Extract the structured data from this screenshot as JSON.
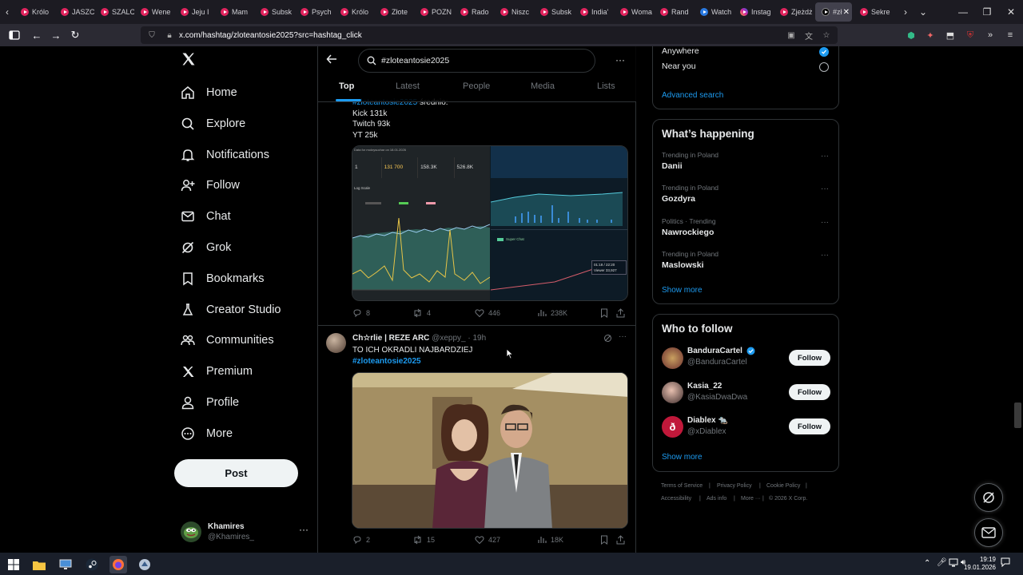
{
  "browser": {
    "tabs": [
      "Królo",
      "JASZC",
      "SZALC",
      "Wene",
      "Jeju I",
      "Mam",
      "Subsk",
      "Psych",
      "Królo",
      "Złote",
      "POZN",
      "Rado",
      "Niszc",
      "Subsk",
      "India'",
      "Woma",
      "Rand",
      "Watch",
      "Instag",
      "Zjeżdż",
      "#zł",
      "Sekre"
    ],
    "url": "x.com/hashtag/zloteantosie2025?src=hashtag_click"
  },
  "nav": {
    "items": [
      "Home",
      "Explore",
      "Notifications",
      "Follow",
      "Chat",
      "Grok",
      "Bookmarks",
      "Creator Studio",
      "Communities",
      "Premium",
      "Profile",
      "More"
    ],
    "post_label": "Post",
    "account_name": "Khamires",
    "account_handle": "@Khamires_"
  },
  "search": {
    "query": "#zloteantosie2025",
    "tabs": [
      "Top",
      "Latest",
      "People",
      "Media",
      "Lists"
    ]
  },
  "tweet1": {
    "partial_line_hashtag": "#zloteantosie2025",
    "partial_line_rest": " średnio:",
    "lines": [
      "Kick 131k",
      "Twitch 93k",
      "YT 25k"
    ],
    "stats": {
      "replies": "8",
      "reposts": "4",
      "likes": "446",
      "views": "238K"
    },
    "chart_left": {
      "header": "Data for mokrysuchar on 18.01.2026",
      "values": [
        "1",
        "131 700",
        "158.3K",
        "526.8K"
      ],
      "scale_label": "Log Scale"
    },
    "chart_right": {
      "super_chat": "Super Chat",
      "tooltip_time": "01:18 / 22:20",
      "tooltip_viewer": "Viewer 33,927"
    }
  },
  "tweet2": {
    "name": "Ch☆rlie | REZE ARC",
    "handle": "@xeppy_",
    "time": "· 19h",
    "text": "TO ICH OKRADLI NAJBARDZIEJ",
    "hashtag": "#zloteantosie2025",
    "stats": {
      "replies": "2",
      "reposts": "15",
      "likes": "427",
      "views": "18K"
    }
  },
  "location": {
    "options": [
      "Anywhere",
      "Near you"
    ],
    "selected": "Anywhere",
    "advanced": "Advanced search"
  },
  "trending": {
    "title": "What’s happening",
    "items": [
      {
        "meta": "Trending in Poland",
        "name": "Danii"
      },
      {
        "meta": "Trending in Poland",
        "name": "Gozdyra"
      },
      {
        "meta": "Politics · Trending",
        "name": "Nawrockiego"
      },
      {
        "meta": "Trending in Poland",
        "name": "Maslowski"
      }
    ],
    "show_more": "Show more"
  },
  "who_to_follow": {
    "title": "Who to follow",
    "accounts": [
      {
        "name": "BanduraCartel",
        "handle": "@BanduraCartel",
        "verified": true
      },
      {
        "name": "Kasia_22",
        "handle": "@KasiaDwaDwa"
      },
      {
        "name": "Diablex 🐀",
        "handle": "@xDiablex"
      }
    ],
    "follow_label": "Follow",
    "show_more": "Show more"
  },
  "footer": [
    "Terms of Service",
    "Privacy Policy",
    "Cookie Policy",
    "Accessibility",
    "Ads info",
    "More ···",
    "© 2026 X Corp."
  ],
  "taskbar": {
    "time": "19:19",
    "date": "19.01.2026"
  },
  "colors": {
    "accent": "#1d9bf0",
    "bg": "#000000",
    "border": "#2f3336",
    "muted": "#71767b"
  }
}
